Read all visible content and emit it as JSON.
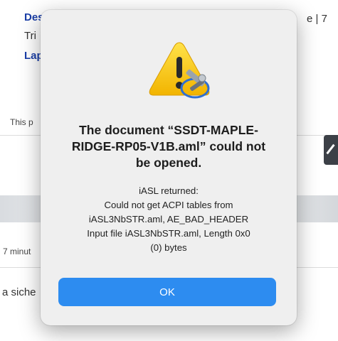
{
  "background": {
    "line1_link": "Des",
    "line1_right": "e | 7",
    "line2": "Tri",
    "line3_link": "Lap",
    "notice": "This p",
    "time": "7 minut",
    "footer": "a siche"
  },
  "dialog": {
    "icon": "warning-triangle-with-tool-icon",
    "title_lines": [
      "The document “SSDT-MAPLE-",
      "RIDGE-RP05-V1B.aml” could not",
      "be opened."
    ],
    "message_lines": [
      "iASL returned:",
      "Could not get ACPI tables from",
      "iASL3NbSTR.aml, AE_BAD_HEADER",
      "Input file iASL3NbSTR.aml, Length 0x0",
      "(0) bytes"
    ],
    "ok_label": "OK"
  },
  "colors": {
    "accent": "#2d8cf0",
    "warning": "#f5c400",
    "dialog_bg": "#efefef"
  }
}
